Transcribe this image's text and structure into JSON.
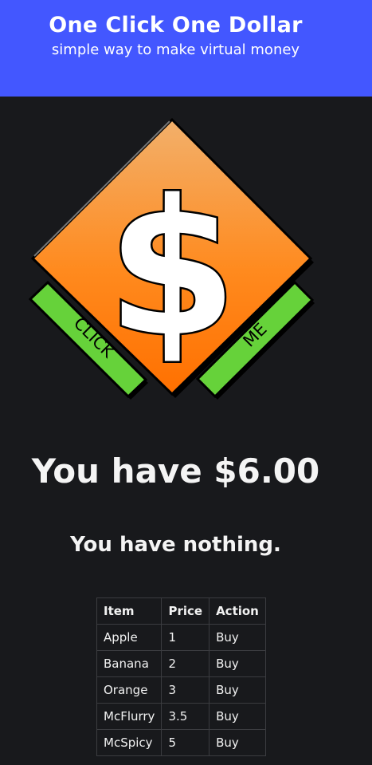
{
  "header": {
    "title": "One Click One Dollar",
    "subtitle": "simple way to make virtual money"
  },
  "button": {
    "symbol": "$",
    "left_text": "CLICK",
    "right_text": "ME"
  },
  "status": {
    "balance": "You have $6.00",
    "inventory": "You have nothing."
  },
  "shop": {
    "headers": [
      "Item",
      "Price",
      "Action"
    ],
    "rows": [
      {
        "item": "Apple",
        "price": "1",
        "action": "Buy"
      },
      {
        "item": "Banana",
        "price": "2",
        "action": "Buy"
      },
      {
        "item": "Orange",
        "price": "3",
        "action": "Buy"
      },
      {
        "item": "McFlurry",
        "price": "3.5",
        "action": "Buy"
      },
      {
        "item": "McSpicy",
        "price": "5",
        "action": "Buy"
      }
    ]
  },
  "colors": {
    "header_bg": "#4357ff",
    "page_bg": "#18191c",
    "diamond_top": "#f2b06b",
    "diamond_bottom": "#ff7700",
    "ribbon": "#66d23a"
  }
}
